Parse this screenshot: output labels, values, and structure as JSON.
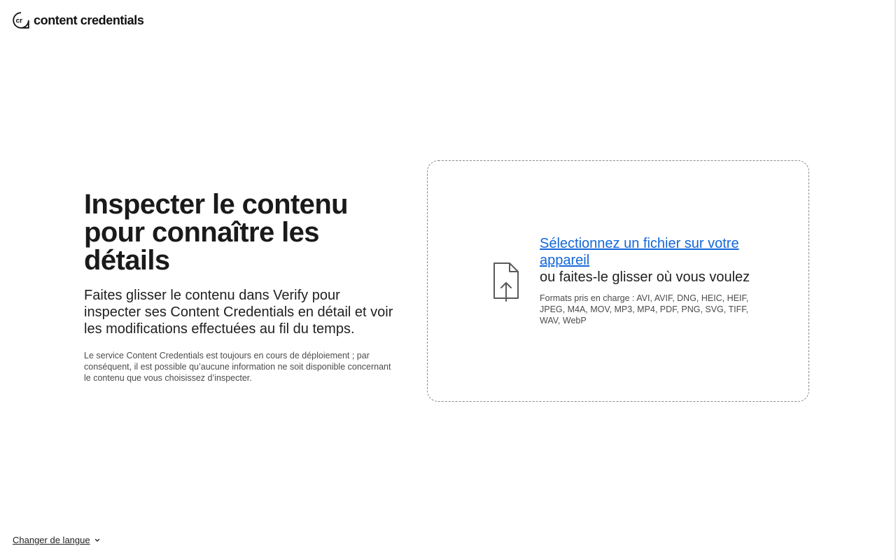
{
  "header": {
    "logo_text": "content credentials",
    "logo_mark": "cr"
  },
  "intro": {
    "title": "Inspecter le contenu pour connaître les détails",
    "lead": "Faites glisser le contenu dans Verify pour inspecter ses Content Credentials en détail et voir les modifications effectuées au fil du temps.",
    "note": "Le service Content Credentials est toujours en cours de déploiement ; par conséquent, il est possible qu’aucune information ne soit disponible concernant le contenu que vous choisissez d’inspecter."
  },
  "dropzone": {
    "icon": "file-upload-icon",
    "select_link": "Sélectionnez un fichier sur votre appareil",
    "drag_text": "ou faites-le glisser où vous voulez",
    "formats": "Formats pris en charge : AVI, AVIF, DNG, HEIC, HEIF, JPEG, M4A, MOV, MP3, MP4, PDF, PNG, SVG, TIFF, WAV, WebP"
  },
  "footer": {
    "language_label": "Changer de langue",
    "language_icon": "chevron-down-icon"
  },
  "colors": {
    "link": "#1467d9",
    "text": "#1f1f1f",
    "muted": "#4b4b4b",
    "border": "#8a8a8a"
  }
}
